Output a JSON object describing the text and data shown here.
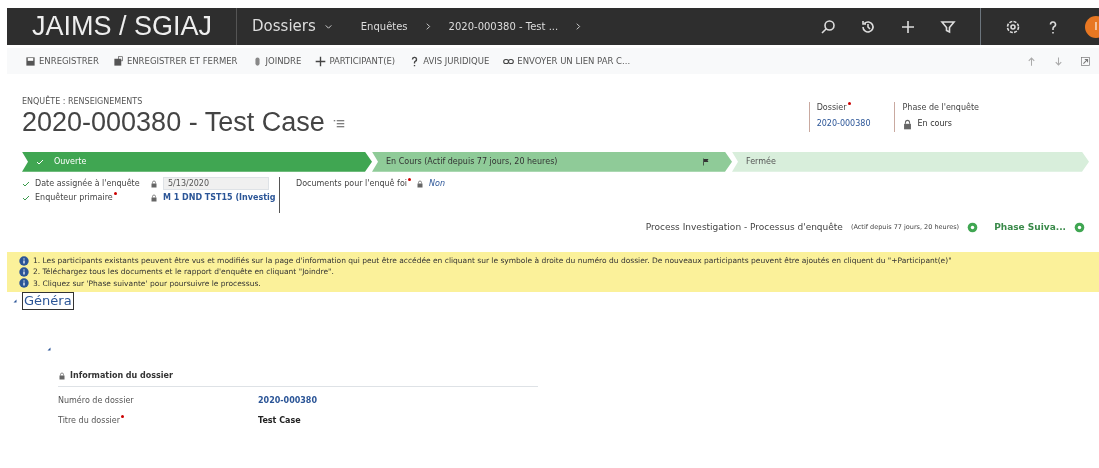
{
  "app": {
    "brand": "JAIMS / SGIAJ",
    "area": "Dossiers",
    "avatar": "I"
  },
  "breadcrumb": [
    "Enquêtes",
    "2020-000380 - Test ..."
  ],
  "toolbar": [
    {
      "kind": "save",
      "label": "ENREGISTRER"
    },
    {
      "kind": "save-close",
      "label": "ENREGISTRER ET FERMER"
    },
    {
      "kind": "attach",
      "label": "JOINDRE"
    },
    {
      "kind": "add",
      "label": "PARTICIPANT(E)"
    },
    {
      "kind": "help",
      "label": "AVIS JURIDIQUE"
    },
    {
      "kind": "link",
      "label": "ENVOYER UN LIEN PAR C..."
    }
  ],
  "header": {
    "form": "ENQUÊTE : RENSEIGNEMENTS",
    "title": "2020-000380 - Test Case",
    "fields": [
      {
        "label": "Dossier",
        "required": true,
        "locked": false,
        "value": "2020-000380"
      },
      {
        "label": "Phase de l'enquête",
        "required": false,
        "locked": true,
        "value": "En cours"
      }
    ]
  },
  "stages": [
    {
      "completed": true,
      "selected": false,
      "label": "Ouverte"
    },
    {
      "completed": false,
      "selected": true,
      "label": "En Cours (Actif depuis 77 jours, 20 heures)"
    },
    {
      "completed": false,
      "selected": false,
      "label": "Fermée"
    }
  ],
  "stage_fields": [
    {
      "label": "Date assignée à l'enquête",
      "checked": true,
      "required": false,
      "kind": "input",
      "value": "5/13/2020"
    },
    {
      "label": "Enquêteur primaire",
      "checked": true,
      "required": true,
      "kind": "link",
      "value": "M 1 DND TST15 (Investig"
    },
    {
      "label": "Documents pour l'enquê foi",
      "checked": false,
      "required": true,
      "kind": "italic",
      "value": "Non"
    }
  ],
  "process": {
    "name": "Process Investigation - Processus d'enquête",
    "duration": "(Actif depuis 77 jours, 20 heures)",
    "next": "Phase Suiva..."
  },
  "notices": [
    "1. Les participants existants peuvent être vus et modifiés sur la page d'information qui peut être accédée en cliquant sur le symbole à droite du numéro du dossier. De nouveaux participants peuvent être ajoutés en cliquent du \"+Participant(e)\"",
    "2. Téléchargez tous les documents et le rapport d'enquête en cliquant \"Joindre\".",
    "3. Cliquez sur 'Phase suivante' pour poursuivre le processus."
  ],
  "section": {
    "tab": "Généra",
    "title": "Information du dossier",
    "rows": [
      {
        "label": "Numéro de dossier",
        "required": false,
        "kind": "link",
        "value": "2020-000380"
      },
      {
        "label": "Titre du dossier",
        "required": true,
        "kind": "bold",
        "value": "Test Case"
      }
    ]
  }
}
